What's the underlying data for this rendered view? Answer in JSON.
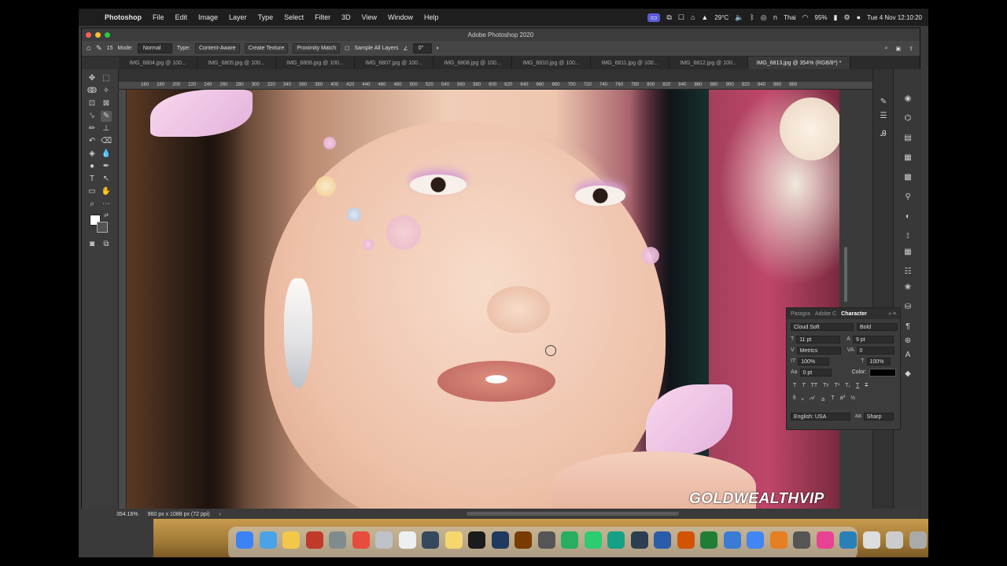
{
  "menubar": {
    "apple": "",
    "items": [
      "Photoshop",
      "File",
      "Edit",
      "Image",
      "Layer",
      "Type",
      "Select",
      "Filter",
      "3D",
      "View",
      "Window",
      "Help"
    ],
    "temperature": "29°C",
    "input_source": "Thai",
    "battery": "95%",
    "clock": "Tue 4 Nov  12:10:20"
  },
  "window": {
    "title": "Adobe Photoshop 2020"
  },
  "options_bar": {
    "brush_size": "15",
    "mode_label": "Mode:",
    "mode_value": "Normal",
    "type_label": "Type:",
    "type_content_aware": "Content-Aware",
    "type_create_texture": "Create Texture",
    "type_proximity_match": "Proximity Match",
    "sample_all_layers": "Sample All Layers",
    "angle_value": "0°"
  },
  "tabs": [
    {
      "label": "IMG_6804.jpg @ 100..."
    },
    {
      "label": "IMG_6805.jpg @ 100..."
    },
    {
      "label": "IMG_6806.jpg @ 100..."
    },
    {
      "label": "IMG_6807.jpg @ 100..."
    },
    {
      "label": "IMG_6808.jpg @ 100..."
    },
    {
      "label": "IMG_6810.jpg @ 100..."
    },
    {
      "label": "IMG_6811.jpg @ 100..."
    },
    {
      "label": "IMG_6812.jpg @ 100..."
    },
    {
      "label": "IMG_6813.jpg @ 354% (RGB/8*) *"
    }
  ],
  "ruler_ticks": [
    "160",
    "180",
    "200",
    "220",
    "240",
    "260",
    "280",
    "300",
    "320",
    "340",
    "360",
    "380",
    "400",
    "420",
    "440",
    "460",
    "480",
    "500",
    "520",
    "540",
    "560",
    "580",
    "600",
    "620",
    "640",
    "660",
    "680",
    "700",
    "720",
    "740",
    "760",
    "780",
    "800",
    "820",
    "840",
    "860",
    "880",
    "900",
    "920",
    "940",
    "960",
    "980"
  ],
  "canvas": {
    "watermark": "GOLDWEALTHVIP"
  },
  "status_bar": {
    "zoom": "354.16%",
    "doc_size": "960 px x 1088 px (72 ppi)"
  },
  "character_panel": {
    "tab_paragraph": "Paragra",
    "tab_adobe": "Adobe C",
    "tab_character": "Character",
    "font_family": "Cloud Soft",
    "font_style": "Bold",
    "font_size": "11 pt",
    "leading": "9 pt",
    "kerning": "Metrics",
    "tracking": "0",
    "vertical_scale": "100%",
    "horizontal_scale": "100%",
    "baseline_shift": "0 pt",
    "color_label": "Color:",
    "language": "English: USA",
    "antialias": "Sharp"
  },
  "colors": {
    "menubar_bg": "#1e1e1e",
    "ps_panel_bg": "#3c3c3c",
    "accent_active": "#5b5bd6",
    "text_color": "#000000"
  }
}
